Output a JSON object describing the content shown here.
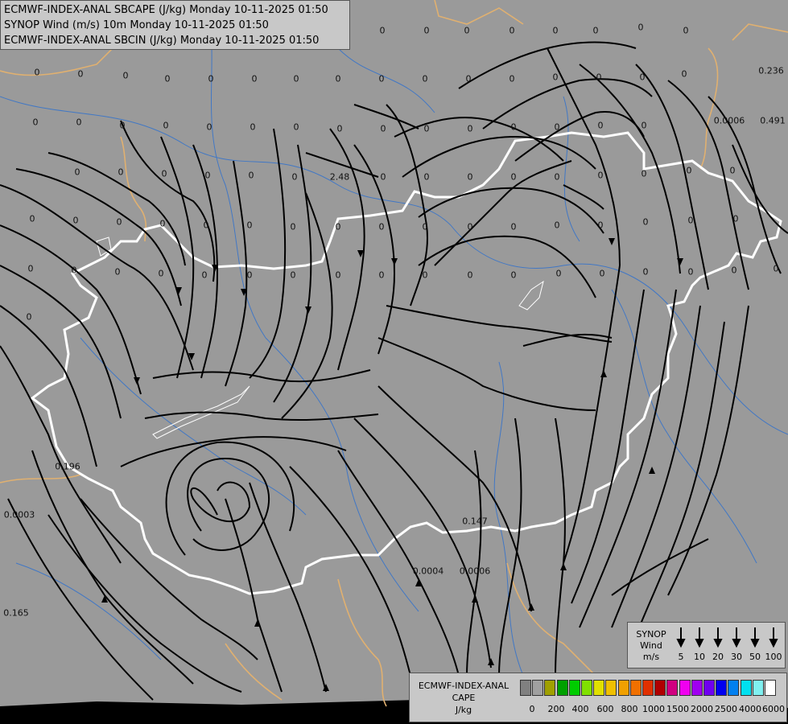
{
  "title": {
    "line1": "ECMWF-INDEX-ANAL SBCAPE (J/kg) Monday 10-11-2025 01:50",
    "line2": "SYNOP Wind (m/s) 10m Monday 10-11-2025 01:50",
    "line3": "ECMWF-INDEX-ANAL SBCIN (J/kg) Monday 10-11-2025 01:50"
  },
  "values": [
    {
      "t": "0"
    },
    {
      "t": "0"
    },
    {
      "t": "0"
    },
    {
      "t": "0"
    },
    {
      "t": "0"
    },
    {
      "t": "0"
    },
    {
      "t": "0"
    },
    {
      "t": "0"
    },
    {
      "t": "0"
    },
    {
      "t": "0"
    },
    {
      "t": "0"
    },
    {
      "t": "0"
    },
    {
      "t": "0"
    },
    {
      "t": "0"
    },
    {
      "t": "0"
    },
    {
      "t": "0"
    },
    {
      "t": "0"
    },
    {
      "t": "0"
    },
    {
      "t": "0"
    },
    {
      "t": "0"
    },
    {
      "t": "0"
    },
    {
      "t": "0"
    },
    {
      "t": "0"
    },
    {
      "t": "0"
    },
    {
      "t": "2.48"
    },
    {
      "t": "0"
    },
    {
      "t": "0"
    },
    {
      "t": "0"
    },
    {
      "t": "0"
    },
    {
      "t": "0"
    },
    {
      "t": "0"
    },
    {
      "t": "0"
    },
    {
      "t": "0"
    },
    {
      "t": "0"
    },
    {
      "t": "0"
    },
    {
      "t": "0"
    },
    {
      "t": "0"
    },
    {
      "t": "0"
    },
    {
      "t": "0"
    },
    {
      "t": "0"
    },
    {
      "t": "0"
    },
    {
      "t": "0"
    },
    {
      "t": "0"
    },
    {
      "t": "0"
    },
    {
      "t": "0"
    },
    {
      "t": "0"
    },
    {
      "t": "0"
    },
    {
      "t": "0"
    },
    {
      "t": "0"
    },
    {
      "t": "0"
    },
    {
      "t": "0"
    },
    {
      "t": "0"
    },
    {
      "t": "0"
    },
    {
      "t": "0"
    },
    {
      "t": "0"
    },
    {
      "t": "0"
    },
    {
      "t": "0"
    },
    {
      "t": "0"
    },
    {
      "t": "0"
    },
    {
      "t": "0"
    },
    {
      "t": "0"
    },
    {
      "t": "0"
    },
    {
      "t": "0"
    },
    {
      "t": "0"
    },
    {
      "t": "0"
    },
    {
      "t": "0"
    },
    {
      "t": "0"
    },
    {
      "t": "0"
    },
    {
      "t": "0"
    },
    {
      "t": "0"
    },
    {
      "t": "0"
    },
    {
      "t": "0"
    },
    {
      "t": "0"
    },
    {
      "t": "0"
    },
    {
      "t": "0"
    },
    {
      "t": "0"
    },
    {
      "t": "0"
    },
    {
      "t": "0"
    },
    {
      "t": "0"
    },
    {
      "t": "0"
    },
    {
      "t": "0.236"
    },
    {
      "t": "0.0006"
    },
    {
      "t": "0.491"
    },
    {
      "t": "0.196"
    },
    {
      "t": "0.0003"
    },
    {
      "t": "0.147"
    },
    {
      "t": "0.0004"
    },
    {
      "t": "0.0006"
    },
    {
      "t": "0.165"
    },
    {
      "t": "0"
    },
    {
      "t": "0"
    },
    {
      "t": "0"
    },
    {
      "t": "0"
    },
    {
      "t": "0"
    },
    {
      "t": "0"
    },
    {
      "t": "0"
    },
    {
      "t": "0"
    },
    {
      "t": "0"
    },
    {
      "t": "0"
    },
    {
      "t": "0"
    }
  ],
  "wind_legend": {
    "line1": "SYNOP",
    "line2": "Wind",
    "line3": "m/s",
    "speeds": [
      "5",
      "10",
      "20",
      "30",
      "50",
      "100"
    ]
  },
  "cape_legend": {
    "line1": "ECMWF-INDEX-ANAL",
    "line2": "CAPE",
    "line3": "J/kg",
    "colors": [
      "#808080",
      "#a0a0a0",
      "#a0a000",
      "#00a000",
      "#00cc00",
      "#80e000",
      "#e0e000",
      "#f0c000",
      "#f0a000",
      "#f07000",
      "#e03000",
      "#b00000",
      "#d00080",
      "#f000f0",
      "#a000f0",
      "#7000f0",
      "#0000f0",
      "#0080f0",
      "#00e0f0",
      "#80f0f0",
      "#ffffff"
    ],
    "ticks": [
      "0",
      "200",
      "400",
      "600",
      "800",
      "1000",
      "1500",
      "2000",
      "2500",
      "4000",
      "6000"
    ]
  }
}
